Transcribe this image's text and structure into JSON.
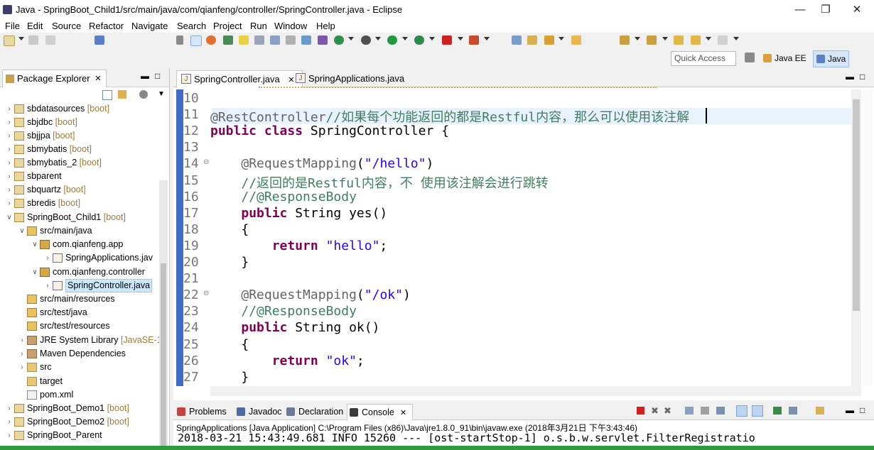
{
  "window": {
    "title": "Java - SpringBoot_Child1/src/main/java/com/qianfeng/controller/SpringController.java - Eclipse"
  },
  "menu": [
    "File",
    "Edit",
    "Source",
    "Refactor",
    "Navigate",
    "Search",
    "Project",
    "Run",
    "Window",
    "Help"
  ],
  "toolbar": {
    "quick_access_placeholder": "Quick Access",
    "perspectives": [
      "Java EE",
      "Java"
    ]
  },
  "package_explorer": {
    "title": "Package Explorer",
    "items": [
      {
        "name": "sbdatasources",
        "deco": "[boot]"
      },
      {
        "name": "sbjdbc",
        "deco": "[boot]"
      },
      {
        "name": "sbjjpa",
        "deco": "[boot]"
      },
      {
        "name": "sbmybatis",
        "deco": "[boot]"
      },
      {
        "name": "sbmybatis_2",
        "deco": "[boot]"
      },
      {
        "name": "sbparent",
        "deco": ""
      },
      {
        "name": "sbquartz",
        "deco": "[boot]"
      },
      {
        "name": "sbredis",
        "deco": "[boot]"
      },
      {
        "name": "SpringBoot_Child1",
        "deco": "[boot]"
      },
      {
        "name": "src/main/java",
        "deco": ""
      },
      {
        "name": "com.qianfeng.app",
        "deco": ""
      },
      {
        "name": "SpringApplications.jav",
        "deco": ""
      },
      {
        "name": "com.qianfeng.controller",
        "deco": ""
      },
      {
        "name": "SpringController.java",
        "deco": ""
      },
      {
        "name": "src/main/resources",
        "deco": ""
      },
      {
        "name": "src/test/java",
        "deco": ""
      },
      {
        "name": "src/test/resources",
        "deco": ""
      },
      {
        "name": "JRE System Library",
        "deco": "[JavaSE-1"
      },
      {
        "name": "Maven Dependencies",
        "deco": ""
      },
      {
        "name": "src",
        "deco": ""
      },
      {
        "name": "target",
        "deco": ""
      },
      {
        "name": "pom.xml",
        "deco": ""
      },
      {
        "name": "SpringBoot_Demo1",
        "deco": "[boot]"
      },
      {
        "name": "SpringBoot_Demo2",
        "deco": "[boot]"
      },
      {
        "name": "SpringBoot_Parent",
        "deco": ""
      }
    ]
  },
  "editor": {
    "tabs": [
      "SpringController.java",
      "SpringApplications.java"
    ],
    "line_numbers": [
      "10",
      "11",
      "12",
      "13",
      "14",
      "15",
      "16",
      "17",
      "18",
      "19",
      "20",
      "21",
      "22",
      "23",
      "24",
      "25",
      "26",
      "27"
    ],
    "lines": [
      {
        "n": "10",
        "parts": []
      },
      {
        "n": "11",
        "parts": [
          {
            "t": "an",
            "v": "@RestController"
          },
          {
            "t": "cm",
            "v": "//如果每个功能返回的都是Restful内容，那么可以使用该注解"
          }
        ]
      },
      {
        "n": "12",
        "parts": [
          {
            "t": "kw",
            "v": "public class "
          },
          {
            "t": "",
            "v": "SpringController {"
          }
        ]
      },
      {
        "n": "13",
        "parts": []
      },
      {
        "n": "14",
        "parts": [
          {
            "t": "",
            "v": "    "
          },
          {
            "t": "an",
            "v": "@RequestMapping"
          },
          {
            "t": "",
            "v": "("
          },
          {
            "t": "str",
            "v": "\"/hello\""
          },
          {
            "t": "",
            "v": ")"
          }
        ]
      },
      {
        "n": "15",
        "parts": [
          {
            "t": "",
            "v": "    "
          },
          {
            "t": "cm",
            "v": "//返回的是Restful内容，不 使用该注解会进行跳转"
          }
        ]
      },
      {
        "n": "16",
        "parts": [
          {
            "t": "",
            "v": "    "
          },
          {
            "t": "cm",
            "v": "//@ResponseBody"
          }
        ]
      },
      {
        "n": "17",
        "parts": [
          {
            "t": "",
            "v": "    "
          },
          {
            "t": "kw",
            "v": "public "
          },
          {
            "t": "",
            "v": "String yes()"
          }
        ]
      },
      {
        "n": "18",
        "parts": [
          {
            "t": "",
            "v": "    {"
          }
        ]
      },
      {
        "n": "19",
        "parts": [
          {
            "t": "",
            "v": "        "
          },
          {
            "t": "kw",
            "v": "return "
          },
          {
            "t": "str",
            "v": "\"hello\""
          },
          {
            "t": "",
            "v": ";"
          }
        ]
      },
      {
        "n": "20",
        "parts": [
          {
            "t": "",
            "v": "    }"
          }
        ]
      },
      {
        "n": "21",
        "parts": []
      },
      {
        "n": "22",
        "parts": [
          {
            "t": "",
            "v": "    "
          },
          {
            "t": "an",
            "v": "@RequestMapping"
          },
          {
            "t": "",
            "v": "("
          },
          {
            "t": "str",
            "v": "\"/ok\""
          },
          {
            "t": "",
            "v": ")"
          }
        ]
      },
      {
        "n": "23",
        "parts": [
          {
            "t": "",
            "v": "    "
          },
          {
            "t": "cm",
            "v": "//@ResponseBody"
          }
        ]
      },
      {
        "n": "24",
        "parts": [
          {
            "t": "",
            "v": "    "
          },
          {
            "t": "kw",
            "v": "public "
          },
          {
            "t": "",
            "v": "String ok()"
          }
        ]
      },
      {
        "n": "25",
        "parts": [
          {
            "t": "",
            "v": "    {"
          }
        ]
      },
      {
        "n": "26",
        "parts": [
          {
            "t": "",
            "v": "        "
          },
          {
            "t": "kw",
            "v": "return "
          },
          {
            "t": "str",
            "v": "\"ok\""
          },
          {
            "t": "",
            "v": ";"
          }
        ]
      },
      {
        "n": "27",
        "parts": [
          {
            "t": "",
            "v": "    }"
          }
        ]
      }
    ]
  },
  "console": {
    "tabs": [
      "Problems",
      "Javadoc",
      "Declaration",
      "Console"
    ],
    "description": "SpringApplications [Java Application] C:\\Program Files (x86)\\Java\\jre1.8.0_91\\bin\\javaw.exe (2018年3月21日 下午3:43:46)",
    "last_line": "2018-03-21 15:43:49.681  INFO 15260 --- [ost-startStop-1] o.s.b.w.servlet.FilterRegistratio"
  },
  "colors": {
    "ruler": "#3e6ec6",
    "keyword": "#7f0055",
    "string": "#2a00ff",
    "comment": "#3f7f5f",
    "annotation": "#646464",
    "status": "#2b9b3c"
  }
}
